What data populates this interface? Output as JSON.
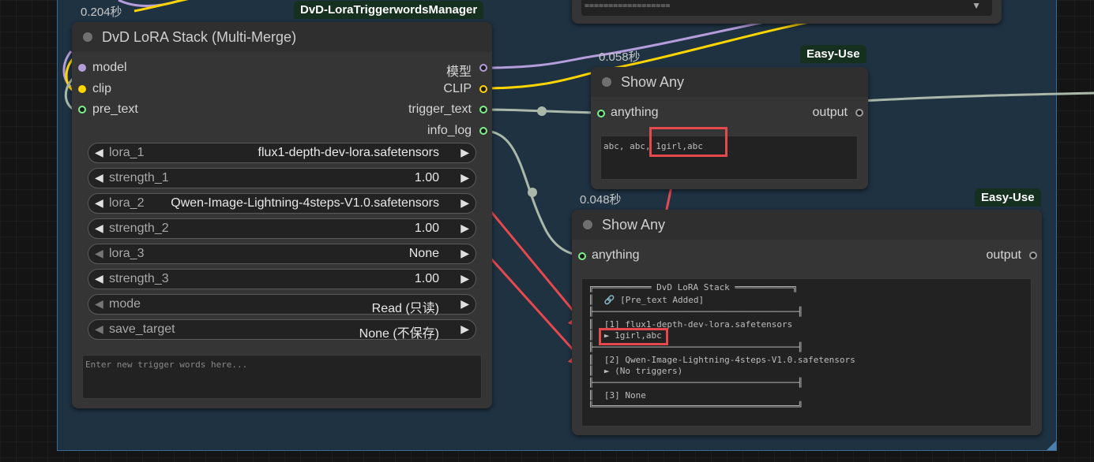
{
  "top_node": {
    "separator": "=================="
  },
  "lora_node": {
    "timing": "0.204秒",
    "badge": "DvD-LoraTriggerwordsManager",
    "title": "DvD LoRA Stack (Multi-Merge)",
    "inputs": [
      "model",
      "clip",
      "pre_text"
    ],
    "outputs": [
      "模型",
      "CLIP",
      "trigger_text",
      "info_log"
    ],
    "widgets": [
      {
        "name": "lora_1",
        "value": "flux1-depth-dev-lora.safetensors"
      },
      {
        "name": "strength_1",
        "value": "1.00"
      },
      {
        "name": "lora_2",
        "value": "Qwen-Image-Lightning-4steps-V1.0.safetensors"
      },
      {
        "name": "strength_2",
        "value": "1.00"
      },
      {
        "name": "lora_3",
        "value": "None"
      },
      {
        "name": "strength_3",
        "value": "1.00"
      },
      {
        "name": "mode",
        "value": "Read (只读)"
      },
      {
        "name": "save_target",
        "value": "None (不保存)"
      }
    ],
    "trigger_placeholder": "Enter new trigger words here..."
  },
  "show_any_1": {
    "timing": "0.058秒",
    "badge": "Easy-Use",
    "title": "Show Any",
    "input": "anything",
    "output": "output",
    "text": "abc, abc, 1girl,abc"
  },
  "show_any_2": {
    "timing": "0.048秒",
    "badge": "Easy-Use",
    "title": "Show Any",
    "input": "anything",
    "output": "output",
    "log": [
      "╔═══════════ DvD LoRA Stack ═══════════╗",
      "║  🔗 [Pre_text Added]",
      "╟───────────────────────────────────────╢",
      "║  [1] flux1-depth-dev-lora.safetensors",
      "║  ► 1girl,abc",
      "╟───────────────────────────────────────╢",
      "║  [2] Qwen-Image-Lightning-4steps-V1.0.safetensors",
      "║  ► (No triggers)",
      "╟───────────────────────────────────────╢",
      "║  [3] None",
      "╚═══════════════════════════════════════╝"
    ]
  },
  "colors": {
    "model": "#b39ddb",
    "clip": "#ffd500",
    "string": "#7cf08a",
    "annotation": "#e5484d"
  }
}
